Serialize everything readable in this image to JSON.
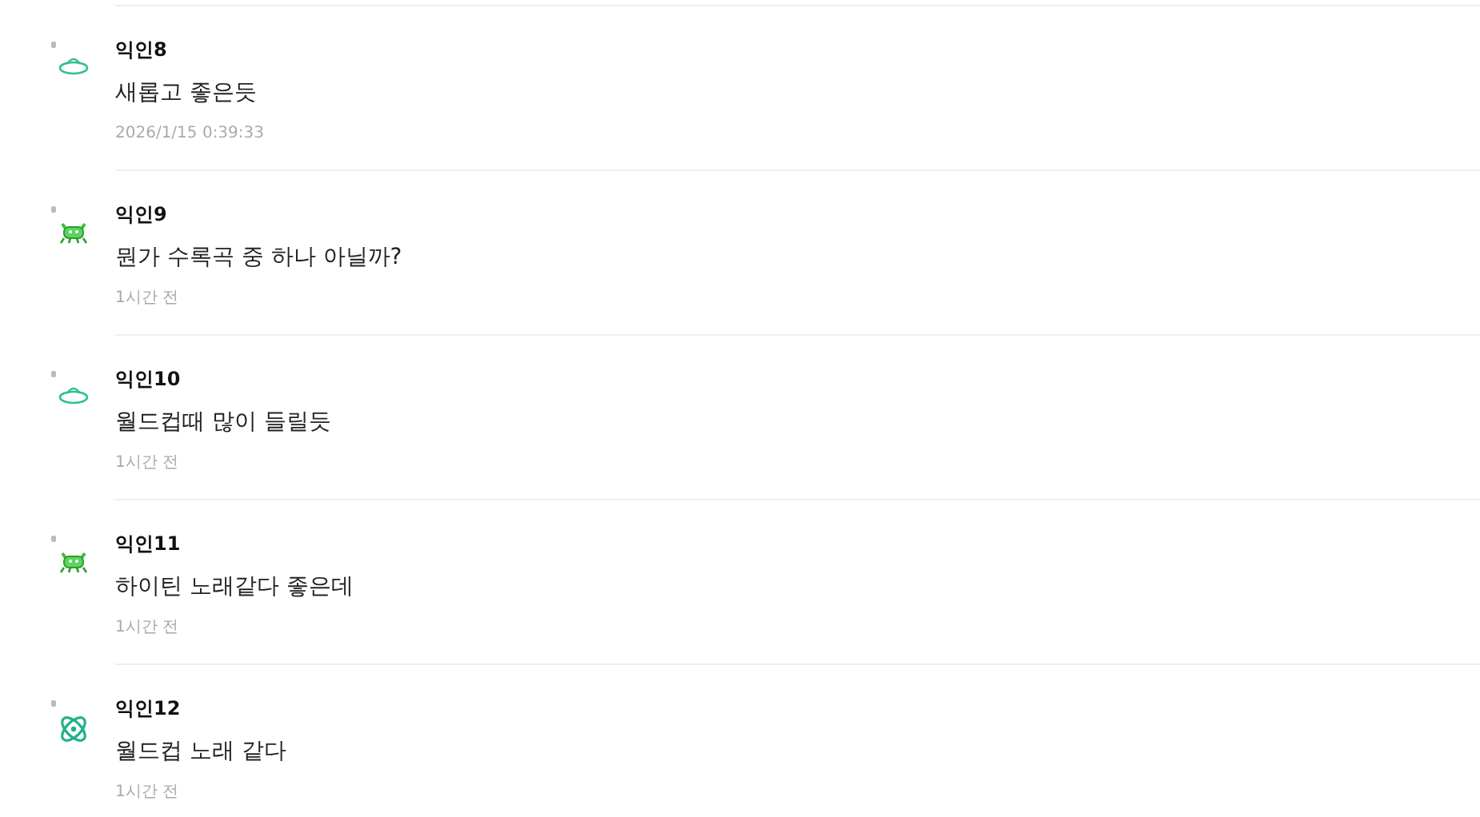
{
  "comments": [
    {
      "kind": "ufo",
      "author": "익인8",
      "text": "새롭고 좋은듯",
      "time": "2026/1/15 0:39:33"
    },
    {
      "kind": "crab",
      "author": "익인9",
      "text": "뭔가 수록곡 중 하나 아닐까?",
      "time": "1시간 전"
    },
    {
      "kind": "ufo",
      "author": "익인10",
      "text": "월드컵때 많이 들릴듯",
      "time": "1시간 전"
    },
    {
      "kind": "crab",
      "author": "익인11",
      "text": "하이틴 노래같다 좋은데",
      "time": "1시간 전"
    },
    {
      "kind": "atom",
      "author": "익인12",
      "text": "월드컵 노래 같다",
      "time": "1시간 전"
    }
  ]
}
